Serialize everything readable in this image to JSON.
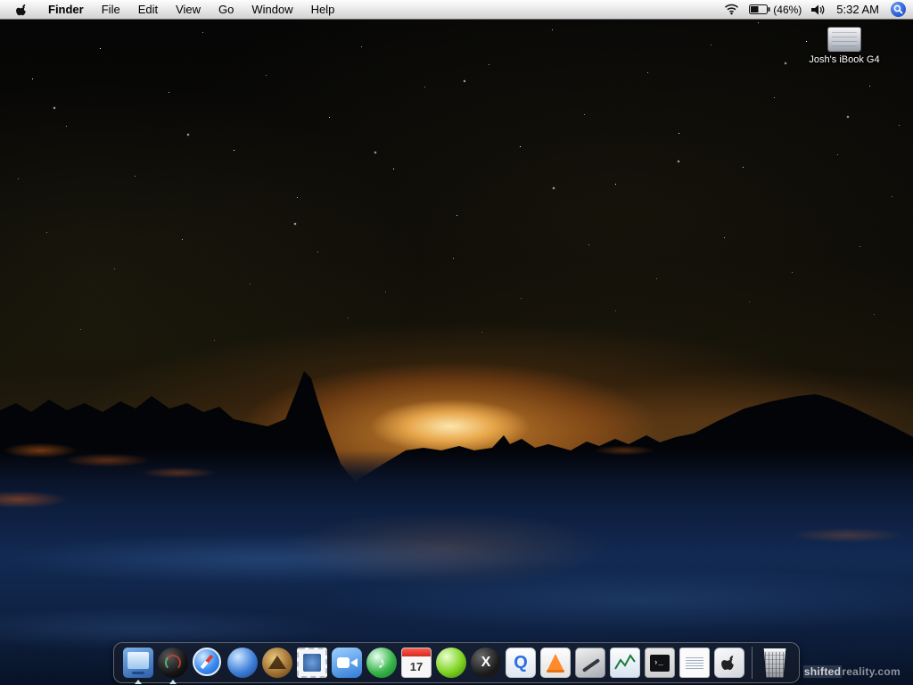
{
  "menu_bar": {
    "apple_menu_icon": "apple-logo",
    "items": [
      "Finder",
      "File",
      "Edit",
      "View",
      "Go",
      "Window",
      "Help"
    ],
    "status": {
      "wifi_icon": "wifi-icon",
      "battery_icon": "battery-icon",
      "battery_percent": "(46%)",
      "volume_icon": "speaker-icon",
      "time": "5:32 AM",
      "spotlight_icon": "spotlight-magnifier-icon"
    }
  },
  "desktop": {
    "disk_label": "Josh's iBook G4",
    "watermark": {
      "part1": "shifted",
      "part2": "reality.com"
    }
  },
  "dock": {
    "calendar_day": "17",
    "items": [
      {
        "label": "Finder",
        "icon": "monitor-icon",
        "running": true
      },
      {
        "label": "Dashboard",
        "icon": "dark-gauge-icon",
        "running": true
      },
      {
        "label": "Safari",
        "icon": "compass-icon",
        "running": false
      },
      {
        "label": "Internet",
        "icon": "blue-orb-icon",
        "running": false
      },
      {
        "label": "Sherlock",
        "icon": "sextant-icon",
        "running": false
      },
      {
        "label": "Mail",
        "icon": "stamp-icon",
        "running": false
      },
      {
        "label": "iChat",
        "icon": "video-camera-icon",
        "running": false
      },
      {
        "label": "iTunes",
        "icon": "music-note-icon",
        "running": false
      },
      {
        "label": "iCal",
        "icon": "calendar-icon",
        "running": false
      },
      {
        "label": "LimeWire",
        "icon": "green-orb-icon",
        "running": false
      },
      {
        "label": "X11",
        "icon": "x11-icon",
        "running": false
      },
      {
        "label": "QuickTime",
        "icon": "quicktime-q-icon",
        "running": false
      },
      {
        "label": "VLC",
        "icon": "traffic-cone-icon",
        "running": false
      },
      {
        "label": "Graphics App",
        "icon": "gray-app-icon",
        "running": false
      },
      {
        "label": "Grapher",
        "icon": "graph-icon",
        "running": false
      },
      {
        "label": "Terminal",
        "icon": "terminal-icon",
        "running": false
      },
      {
        "label": "TextEdit",
        "icon": "document-icon",
        "running": false
      },
      {
        "label": "Apple App",
        "icon": "apple-icon",
        "running": false
      }
    ],
    "trash_label": "Trash"
  },
  "colors": {
    "spotlight_blue": "#2b61d8",
    "sun_glow": "#ffab3c",
    "foreground_blue": "#122a52",
    "menubar_light": "#fdfdfd"
  }
}
